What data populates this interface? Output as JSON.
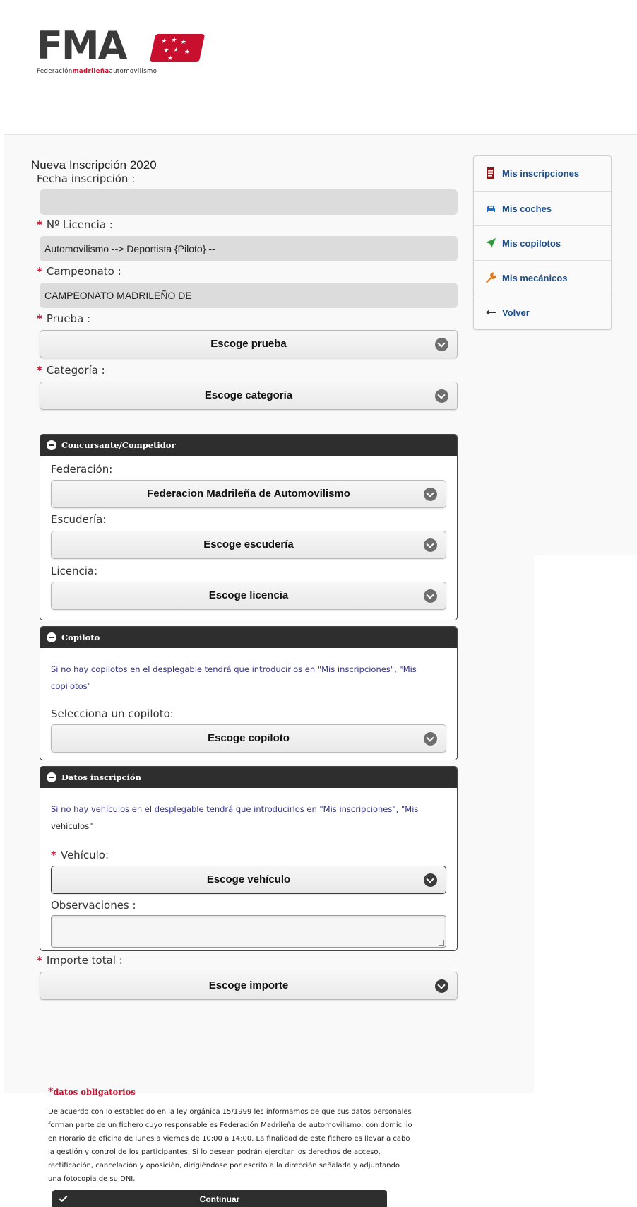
{
  "logo": {
    "letters": "FMA",
    "tagline_pre": "Federación",
    "tagline_mid": "madrileña",
    "tagline_post": "automovilismo"
  },
  "form": {
    "title": "Nueva Inscripción 2020",
    "fecha_label": "Fecha inscripción :",
    "fecha_value": "",
    "licencia_label": "Nº Licencia :",
    "licencia_value": "Automovilismo --> Deportista {Piloto} --",
    "campeonato_label": "Campeonato :",
    "campeonato_value": "CAMPEONATO MADRILEÑO DE",
    "prueba_label": "Prueba :",
    "prueba_select": "Escoge prueba",
    "categoria_label": "Categoría :",
    "categoria_select": "Escoge categoria",
    "required_mark": "*"
  },
  "panel_concursante": {
    "title": "Concursante/Competidor",
    "federacion_label": "Federación:",
    "federacion_select": "Federacion Madrileña de Automovilismo",
    "escuderia_label": "Escudería:",
    "escuderia_select": "Escoge escudería",
    "licencia_label": "Licencia:",
    "licencia_select": "Escoge licencia"
  },
  "panel_copiloto": {
    "title": "Copiloto",
    "note": "Si no hay copilotos en el desplegable tendrá que introducirlos en \"Mis inscripciones\", \"Mis copilotos\"",
    "select_label": "Selecciona un copiloto:",
    "select": "Escoge copiloto"
  },
  "panel_datos": {
    "title": "Datos inscripción",
    "note_main": "Si no hay vehículos en el desplegable tendrá que introducirlos en \"Mis inscripciones\", \"Mis ",
    "note_tail": "vehículos\"",
    "vehiculo_label": "Vehículo:",
    "vehiculo_select": "Escoge vehículo",
    "observaciones_label": "Observaciones :",
    "observaciones_value": ""
  },
  "importe": {
    "label": "Importe total :",
    "select": "Escoge importe"
  },
  "footer": {
    "mandatory_star": "*",
    "mandatory_text": "datos obligatorios",
    "legal": "De acuerdo con lo establecido en la ley orgánica 15/1999 les informamos de que sus datos personales forman parte de un fichero cuyo responsable es Federación Madrileña de automovilismo, con domicilio en Horario de oficina de lunes a viernes de 10:00 a 14:00. La finalidad de este fichero es llevar a cabo la gestión y control de los participantes. Si lo desean podrán ejercitar los derechos de acceso, rectificación, cancelación y oposición, dirigiéndose por escrito a la dirección señalada y adjuntando una fotocopia de su DNI.",
    "continue_label": "Continuar"
  },
  "sidebar": {
    "items": [
      {
        "label": "Mis inscripciones",
        "icon": "document-icon",
        "color": "#8b1a1a"
      },
      {
        "label": "Mis coches",
        "icon": "car-icon",
        "color": "#1f6fd1"
      },
      {
        "label": "Mis copilotos",
        "icon": "location-arrow-icon",
        "color": "#2e9a3a"
      },
      {
        "label": "Mis mecánicos",
        "icon": "wrench-icon",
        "color": "#e07a1c"
      },
      {
        "label": "Volver",
        "icon": "arrow-left-icon",
        "color": "#333333"
      }
    ]
  }
}
